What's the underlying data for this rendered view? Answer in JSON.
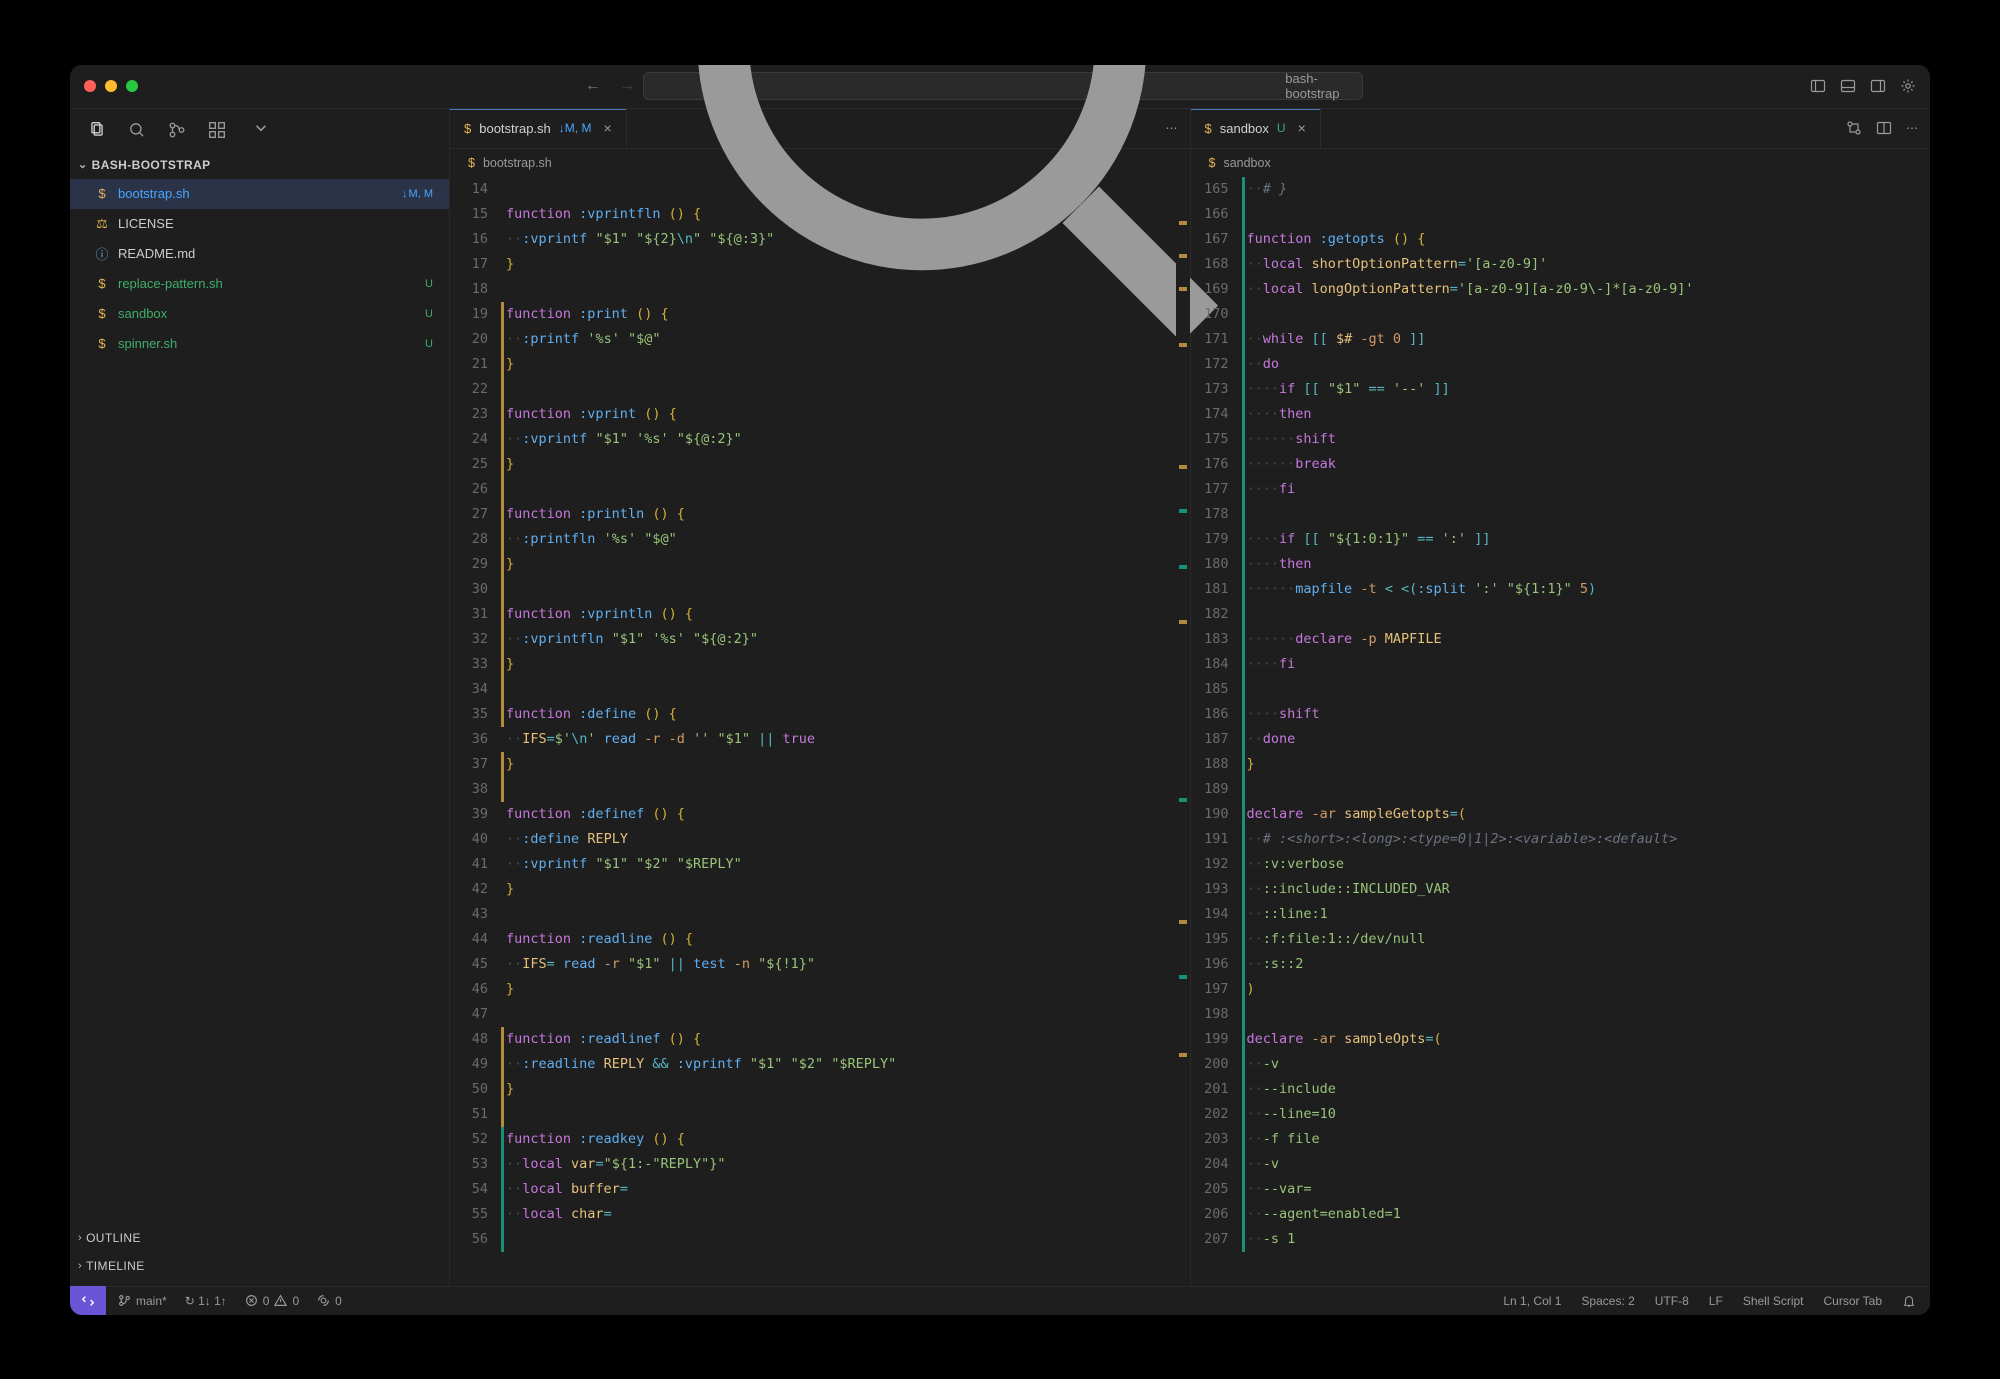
{
  "title": "bash-bootstrap",
  "sidebar": {
    "project": "BASH-BOOTSTRAP",
    "files": [
      {
        "icon": "$",
        "name": "bootstrap.sh",
        "status": "M, M",
        "kind": "mod",
        "selected": true
      },
      {
        "icon": "lic",
        "name": "LICENSE"
      },
      {
        "icon": "i",
        "name": "README.md"
      },
      {
        "icon": "$",
        "name": "replace-pattern.sh",
        "status": "U",
        "kind": "unt"
      },
      {
        "icon": "$",
        "name": "sandbox",
        "status": "U",
        "kind": "unt"
      },
      {
        "icon": "$",
        "name": "spinner.sh",
        "status": "U",
        "kind": "unt"
      }
    ],
    "outline": "OUTLINE",
    "timeline": "TIMELINE"
  },
  "pane_left": {
    "tab": {
      "name": "bootstrap.sh",
      "git": "↓M, M"
    },
    "crumb": "bootstrap.sh",
    "first_line": 14,
    "lines": [
      "",
      "<kw>function</kw> <fn>:vprintfln</fn> <br>()</br> <br>{</br>",
      "<ws>··</ws><fn>:vprintf</fn> <st>\"$1\"</st> <st>\"${2}</st><op>\\n</op><st>\"</st> <st>\"${@:3}\"</st>",
      "<br>}</br>",
      "",
      "<kw>function</kw> <fn>:print</fn> <br>()</br> <br>{</br>",
      "<ws>··</ws><fn>:printf</fn> <st>'%s'</st> <st>\"$@\"</st>",
      "<br>}</br>",
      "",
      "<kw>function</kw> <fn>:vprint</fn> <br>()</br> <br>{</br>",
      "<ws>··</ws><fn>:vprintf</fn> <st>\"$1\"</st> <st>'%s'</st> <st>\"${@:2}\"</st>",
      "<br>}</br>",
      "",
      "<kw>function</kw> <fn>:println</fn> <br>()</br> <br>{</br>",
      "<ws>··</ws><fn>:printfln</fn> <st>'%s'</st> <st>\"$@\"</st>",
      "<br>}</br>",
      "",
      "<kw>function</kw> <fn>:vprintln</fn> <br>()</br> <br>{</br>",
      "<ws>··</ws><fn>:vprintfln</fn> <st>\"$1\"</st> <st>'%s'</st> <st>\"${@:2}\"</st>",
      "<br>}</br>",
      "",
      "<kw>function</kw> <fn>:define</fn> <br>()</br> <br>{</br>",
      "<ws>··</ws><va>IFS</va><op>=</op><st>$'</st><op>\\n</op><st>'</st> <fn>read</fn> <nu>-r</nu> <nu>-d</nu> <st>''</st> <st>\"$1\"</st> <op>||</op> <kw>true</kw>",
      "<br>}</br>",
      "",
      "<kw>function</kw> <fn>:definef</fn> <br>()</br> <br>{</br>",
      "<ws>··</ws><fn>:define</fn> <va>REPLY</va>",
      "<ws>··</ws><fn>:vprintf</fn> <st>\"$1\"</st> <st>\"$2\"</st> <st>\"$REPLY\"</st>",
      "<br>}</br>",
      "",
      "<kw>function</kw> <fn>:readline</fn> <br>()</br> <br>{</br>",
      "<ws>··</ws><va>IFS</va><op>=</op> <fn>read</fn> <nu>-r</nu> <st>\"$1\"</st> <op>||</op> <fn>test</fn> <nu>-n</nu> <st>\"${!1}\"</st>",
      "<br>}</br>",
      "",
      "<kw>function</kw> <fn>:readlinef</fn> <br>()</br> <br>{</br>",
      "<ws>··</ws><fn>:readline</fn> <va>REPLY</va> <op>&&</op> <fn>:vprintf</fn> <st>\"$1\"</st> <st>\"$2\"</st> <st>\"$REPLY\"</st>",
      "<br>}</br>",
      "",
      "<kw>function</kw> <fn>:readkey</fn> <br>()</br> <br>{</br>",
      "<ws>··</ws><kw>local</kw> <va>var</va><op>=</op><st>\"${1:-\"REPLY\"}\"</st>",
      "<ws>··</ws><kw>local</kw> <va>buffer</va><op>=</op>",
      "<ws>··</ws><kw>local</kw> <va>char</va><op>=</op>",
      ""
    ],
    "git_marks": [
      {
        "from": 19,
        "to": 22,
        "color": "warn"
      },
      {
        "from": 23,
        "to": 26,
        "color": "warn"
      },
      {
        "from": 27,
        "to": 34,
        "color": "warn"
      },
      {
        "from": 35,
        "to": 35,
        "color": "warn"
      },
      {
        "from": 37,
        "to": 38,
        "color": "warn"
      },
      {
        "from": 48,
        "to": 51,
        "color": "warn"
      },
      {
        "from": 52,
        "to": 56,
        "color": "teal"
      }
    ],
    "overview": [
      {
        "pos": 4,
        "color": "warn"
      },
      {
        "pos": 7,
        "color": "warn"
      },
      {
        "pos": 10,
        "color": "warn"
      },
      {
        "pos": 15,
        "color": "warn"
      },
      {
        "pos": 26,
        "color": "warn"
      },
      {
        "pos": 30,
        "color": "teal"
      },
      {
        "pos": 35,
        "color": "teal"
      },
      {
        "pos": 40,
        "color": "warn"
      },
      {
        "pos": 56,
        "color": "teal"
      },
      {
        "pos": 67,
        "color": "warn"
      },
      {
        "pos": 72,
        "color": "teal"
      },
      {
        "pos": 79,
        "color": "warn"
      }
    ]
  },
  "pane_right": {
    "tab": {
      "name": "sandbox",
      "git": "U"
    },
    "crumb": "sandbox",
    "first_line": 165,
    "lines": [
      "<ws>··</ws><cm># }</cm>",
      "",
      "<kw>function</kw> <fn>:getopts</fn> <br>()</br> <br>{</br>",
      "<ws>··</ws><kw>local</kw> <va>shortOptionPattern</va><op>=</op><st>'[a-z0-9]'</st>",
      "<ws>··</ws><kw>local</kw> <va>longOptionPattern</va><op>=</op><st>'[a-z0-9][a-z0-9\\-]*[a-z0-9]'</st>",
      "",
      "<ws>··</ws><kw>while</kw> <op>[[</op> <va>$#</va> <nu>-gt</nu> <nu>0</nu> <op>]]</op>",
      "<ws>··</ws><kw>do</kw>",
      "<ws>····</ws><kw>if</kw> <op>[[</op> <st>\"$1\"</st> <op>==</op> <st>'--'</st> <op>]]</op>",
      "<ws>····</ws><kw>then</kw>",
      "<ws>······</ws><kw>shift</kw>",
      "<ws>······</ws><kw>break</kw>",
      "<ws>····</ws><kw>fi</kw>",
      "",
      "<ws>····</ws><kw>if</kw> <op>[[</op> <st>\"${1:0:1}\"</st> <op>==</op> <st>':'</st> <op>]]</op>",
      "<ws>····</ws><kw>then</kw>",
      "<ws>······</ws><fn>mapfile</fn> <nu>-t</nu> <op>&lt;</op> <op>&lt;(</op><fn>:split</fn> <st>':'</st> <st>\"${1:1}\"</st> <nu>5</nu><op>)</op>",
      "",
      "<ws>······</ws><kw>declare</kw> <nu>-p</nu> <va>MAPFILE</va>",
      "<ws>····</ws><kw>fi</kw>",
      "",
      "<ws>····</ws><kw>shift</kw>",
      "<ws>··</ws><kw>done</kw>",
      "<br>}</br>",
      "",
      "<kw>declare</kw> <nu>-ar</nu> <va>sampleGetopts</va><op>=</op><br>(</br>",
      "<ws>··</ws><cm># :&lt;short&gt;:&lt;long&gt;:&lt;type=0|1|2&gt;:&lt;variable&gt;:&lt;default&gt;</cm>",
      "<ws>··</ws><st>:v:verbose</st>",
      "<ws>··</ws><st>::include::INCLUDED_VAR</st>",
      "<ws>··</ws><st>::line:1</st>",
      "<ws>··</ws><st>:f:file:1::/dev/null</st>",
      "<ws>··</ws><st>:s::2</st>",
      "<br>)</br>",
      "",
      "<kw>declare</kw> <nu>-ar</nu> <va>sampleOpts</va><op>=</op><br>(</br>",
      "<ws>··</ws><st>-v</st>",
      "<ws>··</ws><st>--include</st>",
      "<ws>··</ws><st>--line=10</st>",
      "<ws>··</ws><st>-f file</st>",
      "<ws>··</ws><st>-v</st>",
      "<ws>··</ws><st>--var=</st>",
      "<ws>··</ws><st>--agent=enabled=1</st>",
      "<ws>··</ws><st>-s 1</st>"
    ],
    "git_marks": [
      {
        "from": 165,
        "to": 207,
        "color": "teal"
      }
    ]
  },
  "status": {
    "branch": "main*",
    "sync": "↻ 1↓ 1↑",
    "errors": "0",
    "warnings": "0",
    "ports": "0",
    "cursor": "Ln 1, Col 1",
    "spaces": "Spaces: 2",
    "enc": "UTF-8",
    "eol": "LF",
    "lang": "Shell Script",
    "cursor_tab": "Cursor Tab"
  }
}
